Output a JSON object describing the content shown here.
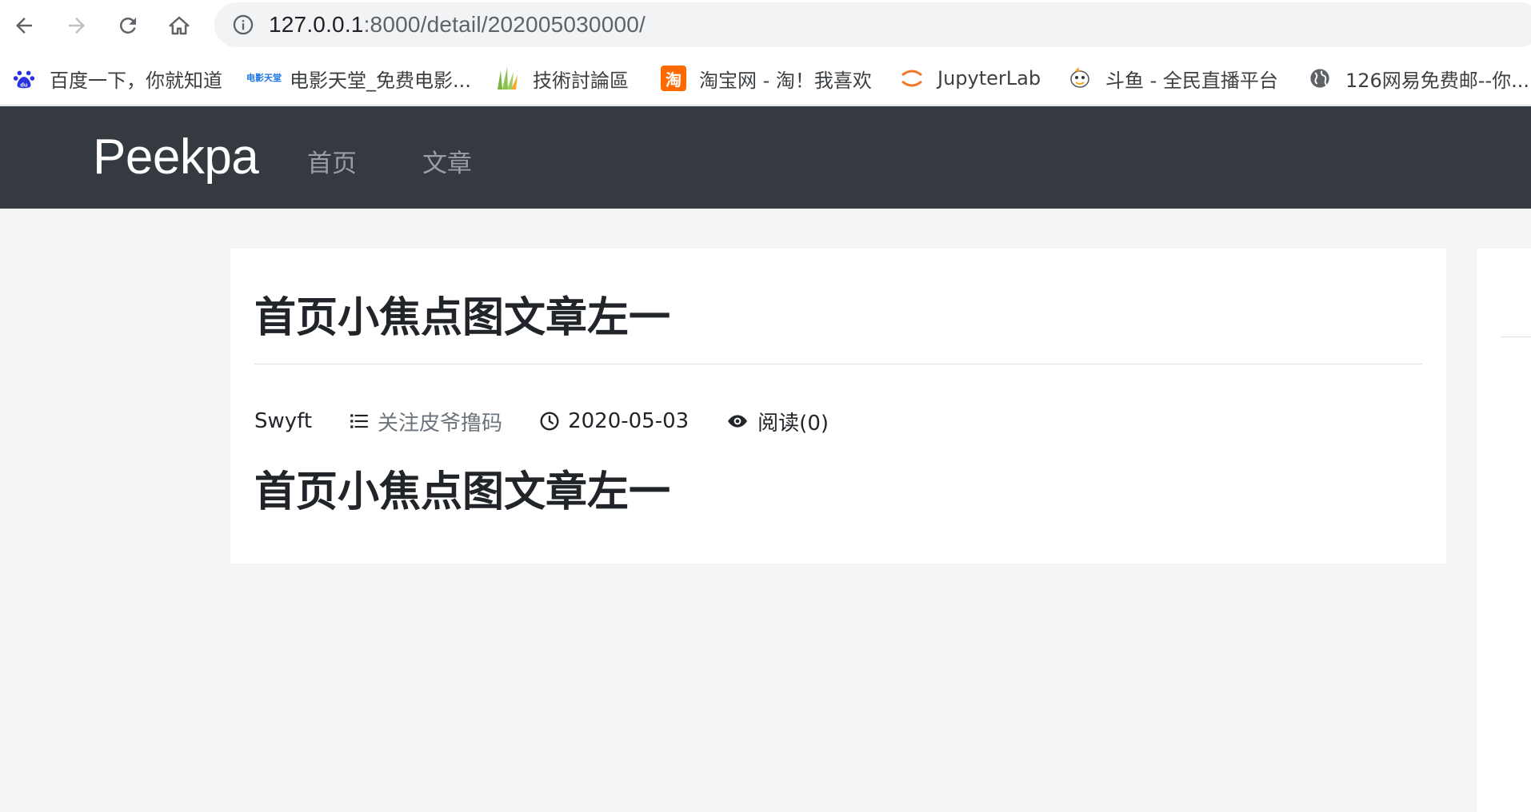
{
  "browser": {
    "url_host": "127.0.0.1",
    "url_rest": ":8000/detail/202005030000/",
    "bookmarks": [
      {
        "label": "百度一下，你就知道",
        "icon": "baidu-paw-icon"
      },
      {
        "label": "电影天堂_免费电影...",
        "icon": "dytt-icon",
        "icon_text": "电影天堂"
      },
      {
        "label": "技術討論區",
        "icon": "grass-icon"
      },
      {
        "label": "淘宝网 - 淘！我喜欢",
        "icon": "taobao-icon",
        "icon_text": "淘"
      },
      {
        "label": "JupyterLab",
        "icon": "jupyter-icon"
      },
      {
        "label": "斗鱼 - 全民直播平台",
        "icon": "douyu-icon"
      },
      {
        "label": "126网易免费邮--你...",
        "icon": "globe-icon"
      }
    ]
  },
  "site": {
    "brand": "Peekpa",
    "nav": [
      {
        "label": "首页"
      },
      {
        "label": "文章"
      }
    ]
  },
  "article": {
    "title": "首页小焦点图文章左一",
    "author": "Swyft",
    "category": "关注皮爷撸码",
    "date": "2020-05-03",
    "views": "阅读(0)",
    "body_title": "首页小焦点图文章左一"
  },
  "sidebar": {
    "title_fragment": "『"
  },
  "colors": {
    "navbar_bg": "#343a40",
    "page_bg": "#f4f5f7",
    "card_bg": "#ffffff"
  }
}
